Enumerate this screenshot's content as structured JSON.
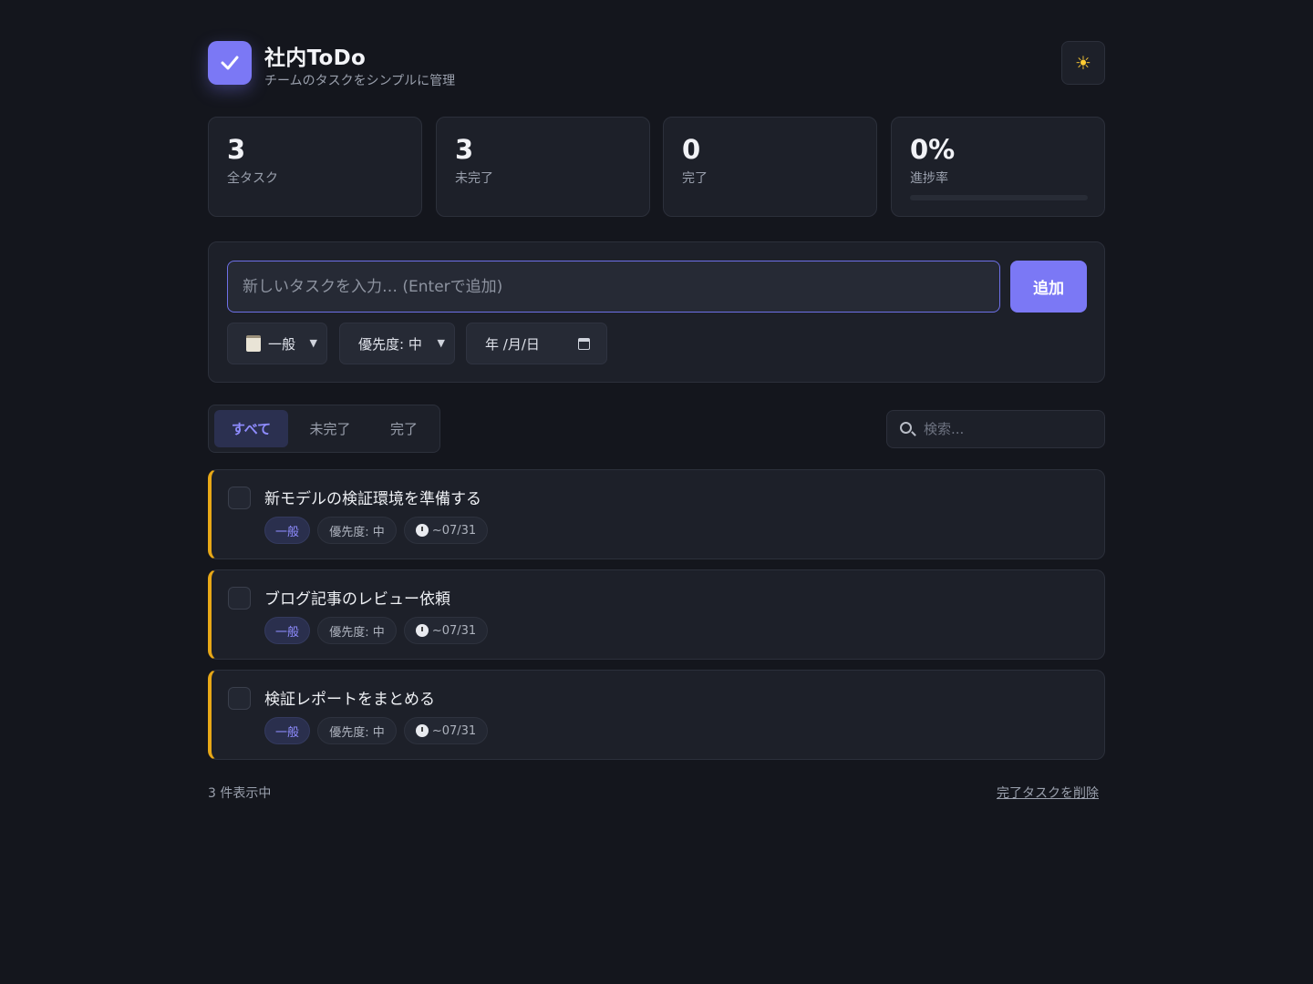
{
  "header": {
    "title": "社内ToDo",
    "subtitle": "チームのタスクをシンプルに管理",
    "logo_icon": "checkmark-icon",
    "theme_icon": "sun-icon",
    "theme_glyph": "☀",
    "accent": "#7b78f5"
  },
  "stats": [
    {
      "value": "3",
      "label": "全タスク"
    },
    {
      "value": "3",
      "label": "未完了"
    },
    {
      "value": "0",
      "label": "完了"
    },
    {
      "value": "0%",
      "label": "進捗率",
      "progress": 0
    }
  ],
  "add_form": {
    "placeholder": "新しいタスクを入力… (Enterで追加)",
    "value": "",
    "add_label": "追加",
    "category": {
      "icon": "clipboard-icon",
      "value": "一般"
    },
    "priority": {
      "value": "優先度: 中"
    },
    "date": {
      "value": "年 /月/日",
      "icon": "calendar-icon"
    }
  },
  "filters": {
    "tabs": [
      "すべて",
      "未完了",
      "完了"
    ],
    "active": "すべて",
    "search_placeholder": "検索..."
  },
  "tasks": [
    {
      "title": "新モデルの検証環境を準備する",
      "category": "一般",
      "priority": "優先度: 中",
      "due": "~07/31",
      "done": false,
      "priority_color": "#e8a817"
    },
    {
      "title": "ブログ記事のレビュー依頼",
      "category": "一般",
      "priority": "優先度: 中",
      "due": "~07/31",
      "done": false,
      "priority_color": "#e8a817"
    },
    {
      "title": "検証レポートをまとめる",
      "category": "一般",
      "priority": "優先度: 中",
      "due": "~07/31",
      "done": false,
      "priority_color": "#e8a817"
    }
  ],
  "footer": {
    "count_text": "3 件表示中",
    "clear_label": "完了タスクを削除"
  }
}
